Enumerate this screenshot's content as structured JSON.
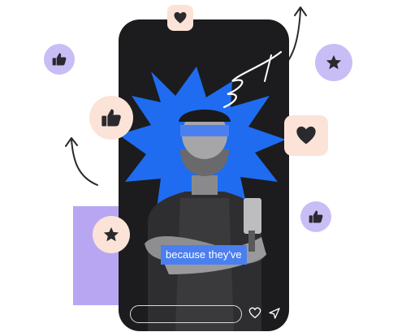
{
  "story": {
    "caption": "because they've"
  },
  "colors": {
    "accent_blue": "#1f6cf0",
    "caption_bg": "#4b7ff0",
    "phone_bg": "#1c1c1e",
    "lavender": "#c9bdf6",
    "peach": "#fbe3d7",
    "icon_dark": "#2a2a2e"
  },
  "icons": [
    "heart-icon",
    "star-icon",
    "thumbs-up-icon",
    "send-icon",
    "arrow-icon"
  ]
}
